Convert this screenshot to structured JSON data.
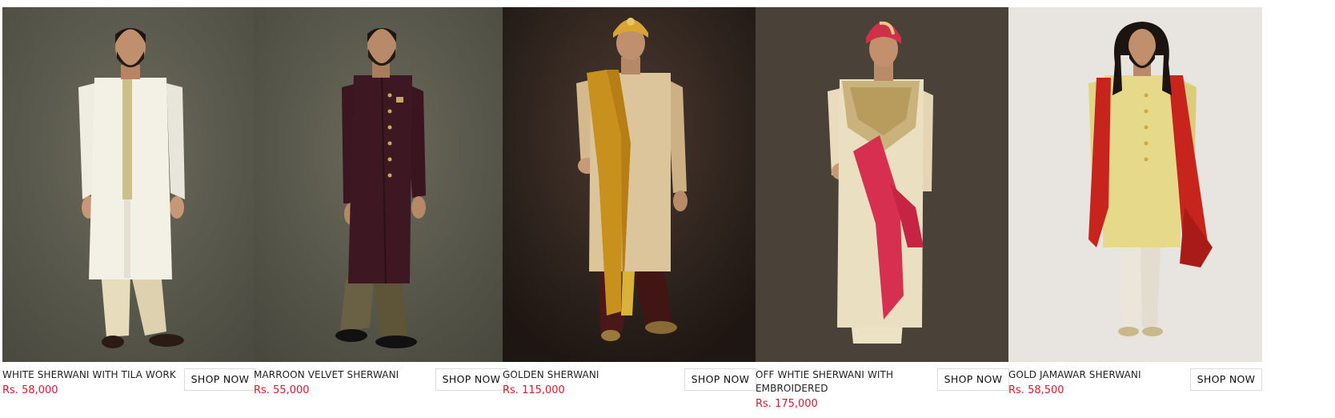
{
  "products": [
    {
      "title": "WHITE SHERWANI WITH TILA WORK",
      "price": "Rs. 58,000",
      "shop_label": "SHOP NOW",
      "image_alt": "white-sherwani-photo"
    },
    {
      "title": "MARROON VELVET SHERWANI",
      "price": "Rs. 55,000",
      "shop_label": "SHOP NOW",
      "image_alt": "maroon-velvet-sherwani-photo"
    },
    {
      "title": "GOLDEN SHERWANI",
      "price": "Rs. 115,000",
      "shop_label": "SHOP NOW",
      "image_alt": "golden-sherwani-photo"
    },
    {
      "title": "OFF WHTIE SHERWANI WITH EMBROIDERED",
      "price": "Rs. 175,000",
      "shop_label": "SHOP NOW",
      "image_alt": "off-white-sherwani-photo"
    },
    {
      "title": "GOLD JAMAWAR SHERWANI",
      "price": "Rs. 58,500",
      "shop_label": "SHOP NOW",
      "image_alt": "gold-jamawar-sherwani-photo"
    }
  ],
  "colors": {
    "price": "#e0182d",
    "button_border": "#dcdcdc"
  }
}
